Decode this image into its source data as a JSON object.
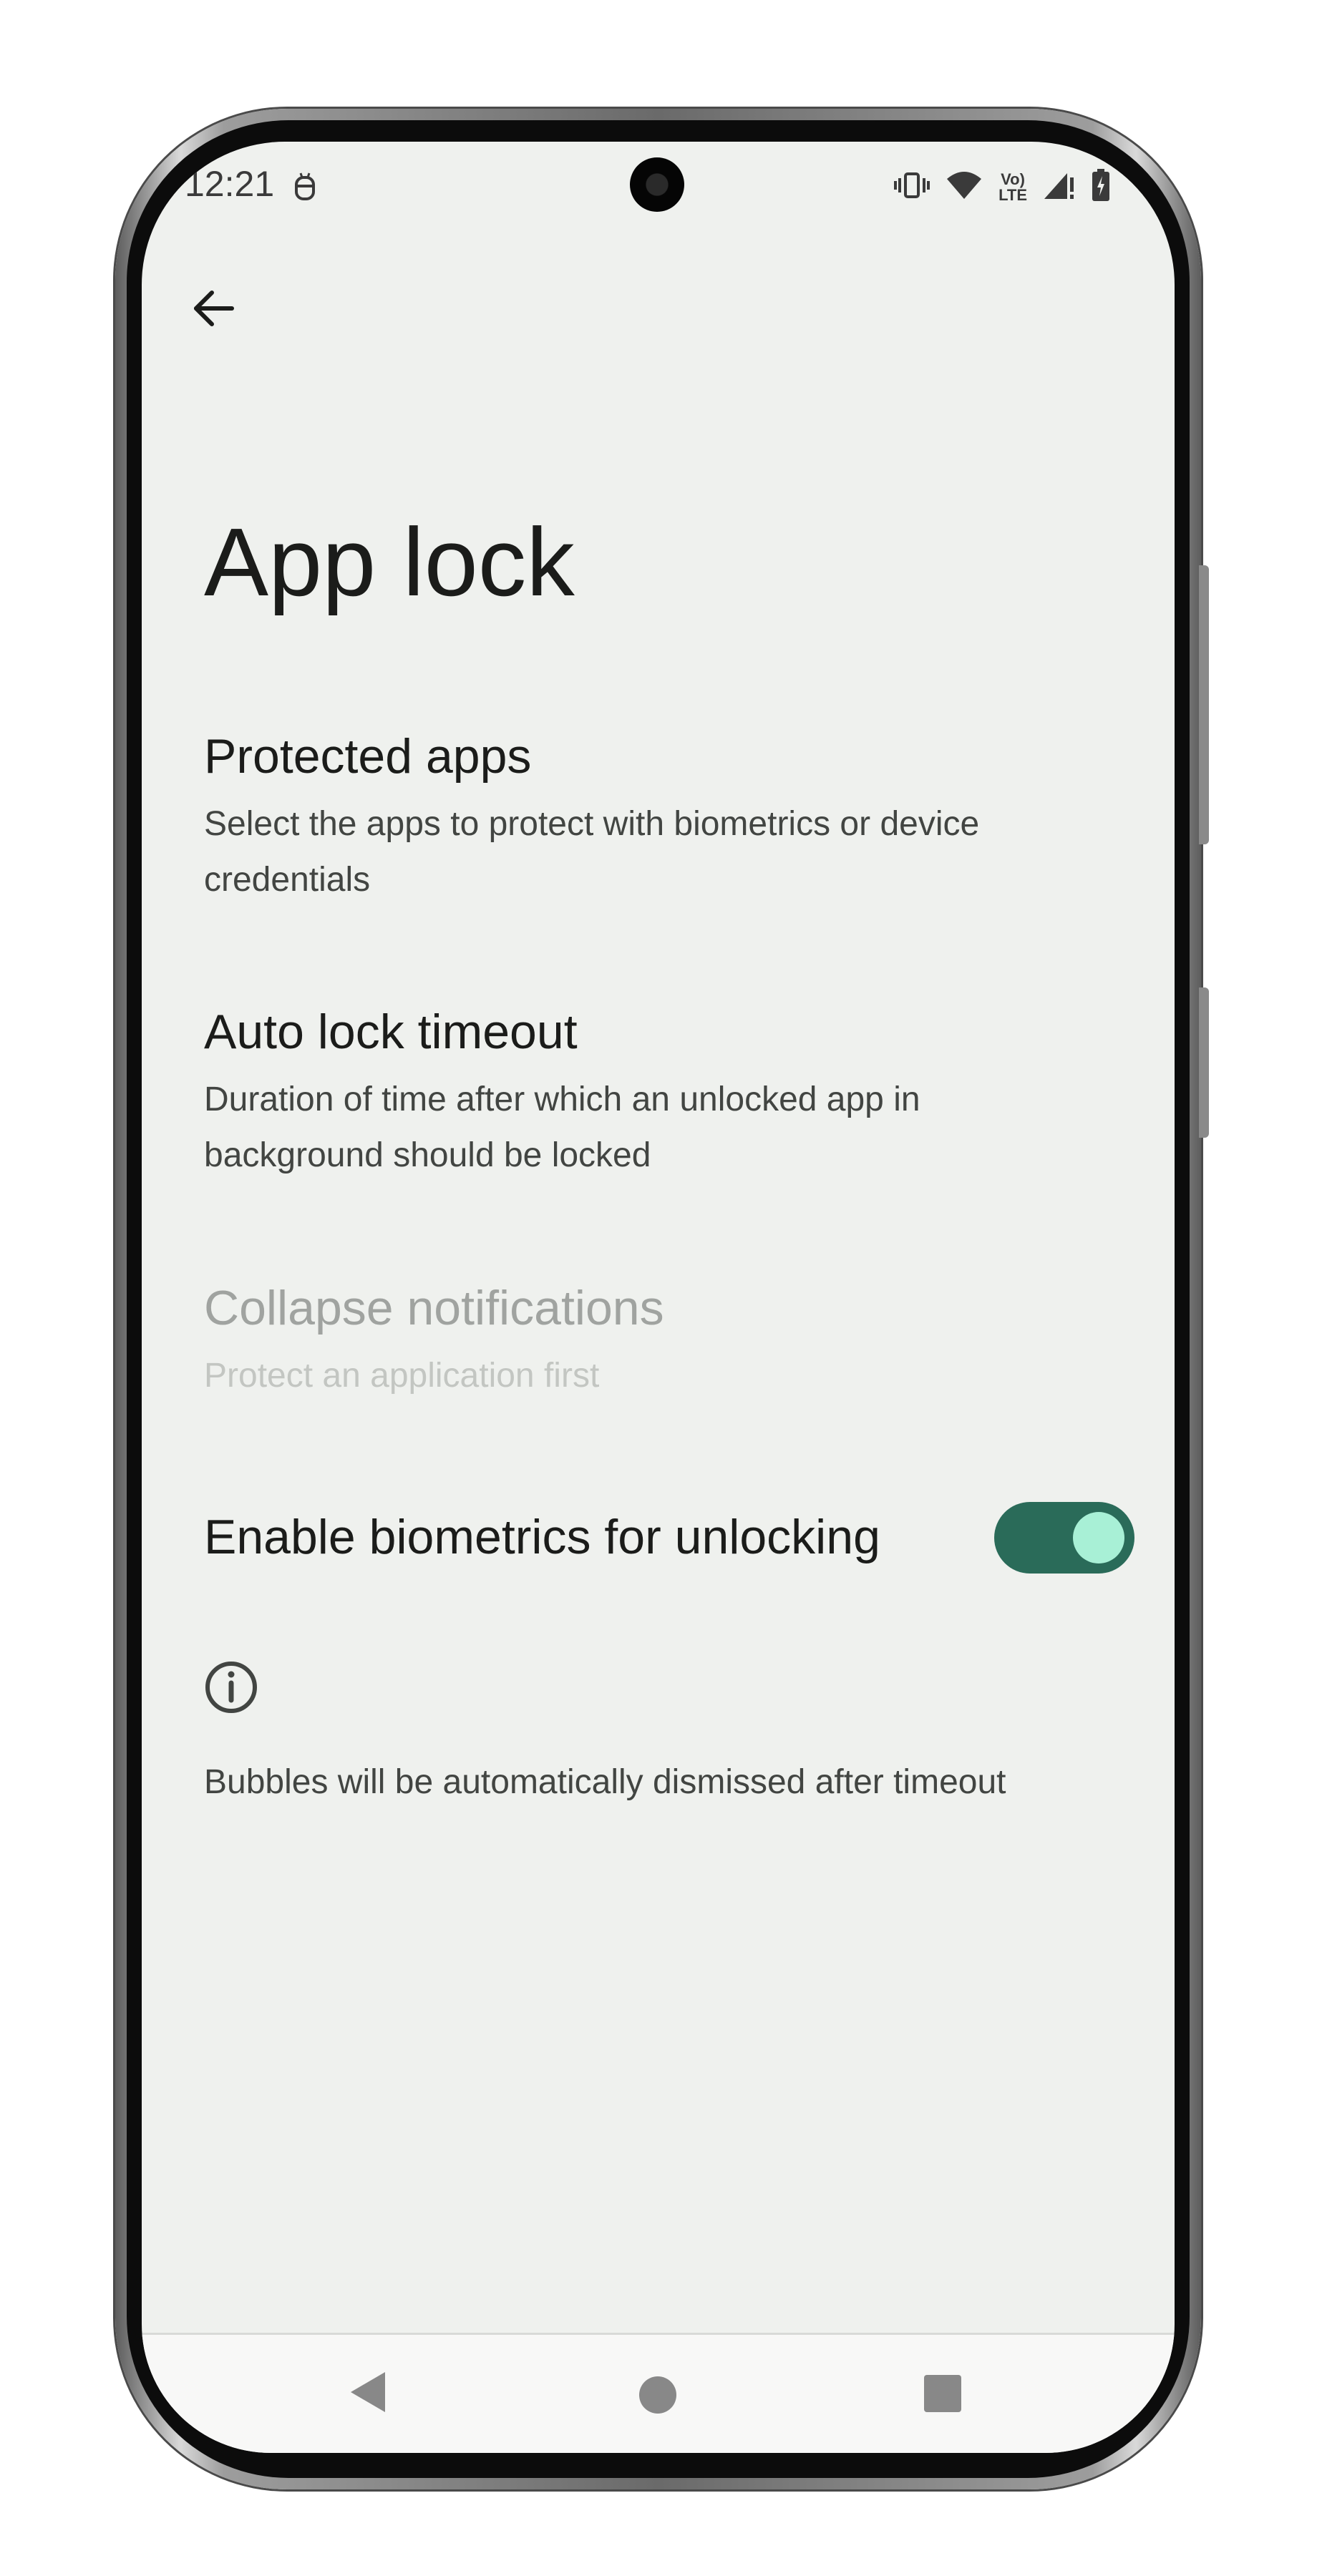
{
  "status_bar": {
    "time": "12:21",
    "volte_line1": "Vo)",
    "volte_line2": "LTE"
  },
  "page": {
    "title": "App lock"
  },
  "preferences": [
    {
      "title": "Protected apps",
      "summary_line1": "Select the apps to protect with biometrics or device",
      "summary_line2": "credentials",
      "enabled": true
    },
    {
      "title": "Auto lock timeout",
      "summary_line1": "Duration of time after which an unlocked app in",
      "summary_line2": "background should be locked",
      "enabled": true
    },
    {
      "title": "Collapse notifications",
      "summary_line1": "Protect an application first",
      "enabled": false
    },
    {
      "title": "Enable biometrics for unlocking",
      "toggle_on": true
    }
  ],
  "footer": {
    "text": "Bubbles will be automatically dismissed after timeout"
  },
  "colors": {
    "background": "#eff1ee",
    "toggle_track": "#2a6b59",
    "toggle_knob": "#a8f0d6",
    "primary_text": "#1b1c1a",
    "secondary_text": "#424542"
  },
  "icons": {
    "back": "arrow-back-icon",
    "info": "info-icon",
    "status": [
      "debug-icon",
      "vibrate-icon",
      "wifi-icon",
      "volte-icon",
      "signal-icon",
      "battery-charging-icon"
    ],
    "nav": [
      "nav-back-icon",
      "nav-home-icon",
      "nav-recents-icon"
    ]
  }
}
